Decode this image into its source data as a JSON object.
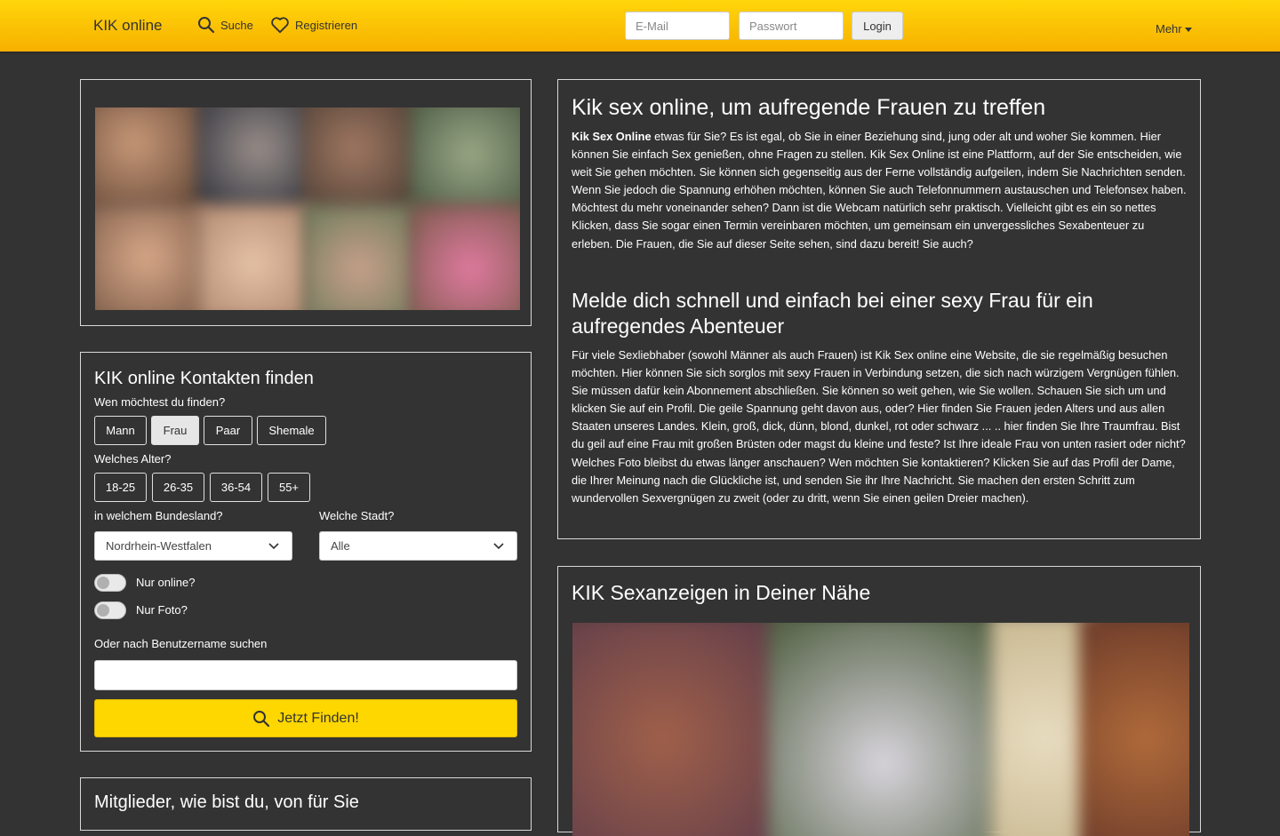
{
  "nav": {
    "brand": "KIK online",
    "search_label": "Suche",
    "register_label": "Registrieren",
    "email_placeholder": "E-Mail",
    "password_placeholder": "Passwort",
    "login_label": "Login",
    "more_label": "Mehr"
  },
  "search": {
    "title": "KIK online Kontakten finden",
    "who_label": "Wen möchtest du finden?",
    "genders": [
      "Mann",
      "Frau",
      "Paar",
      "Shemale"
    ],
    "gender_selected": "Frau",
    "age_label": "Welches Alter?",
    "ages": [
      "18-25",
      "26-35",
      "36-54",
      "55+"
    ],
    "state_label": "in welchem Bundesland?",
    "state_value": "Nordrhein-Westfalen",
    "city_label": "Welche Stadt?",
    "city_value": "Alle",
    "online_label": "Nur online?",
    "photo_label": "Nur Foto?",
    "username_label": "Oder nach Benutzername suchen",
    "username_value": "",
    "find_label": "Jetzt Finden!"
  },
  "members": {
    "title": "Mitglieder, wie bist du, von für Sie"
  },
  "article": {
    "title1": "Kik sex online, um aufregende Frauen zu treffen",
    "p1_strong": "Kik Sex Online",
    "p1_rest": " etwas für Sie? Es ist egal, ob Sie in einer Beziehung sind, jung oder alt und woher Sie kommen. Hier können Sie einfach Sex genießen, ohne Fragen zu stellen. Kik Sex Online ist eine Plattform, auf der Sie entscheiden, wie weit Sie gehen möchten. Sie können sich gegenseitig aus der Ferne vollständig aufgeilen, indem Sie Nachrichten senden. Wenn Sie jedoch die Spannung erhöhen möchten, können Sie auch Telefonnummern austauschen und Telefonsex haben. Möchtest du mehr voneinander sehen? Dann ist die Webcam natürlich sehr praktisch. Vielleicht gibt es ein so nettes Klicken, dass Sie sogar einen Termin vereinbaren möchten, um gemeinsam ein unvergessliches Sexabenteuer zu erleben. Die Frauen, die Sie auf dieser Seite sehen, sind dazu bereit! Sie auch?",
    "title2": "Melde dich schnell und einfach bei einer sexy Frau für ein aufregendes Abenteuer",
    "p2": "Für viele Sexliebhaber (sowohl Männer als auch Frauen) ist Kik Sex online eine Website, die sie regelmäßig besuchen möchten. Hier können Sie sich sorglos mit sexy Frauen in Verbindung setzen, die sich nach würzigem Vergnügen fühlen. Sie müssen dafür kein Abonnement abschließen. Sie können so weit gehen, wie Sie wollen. Schauen Sie sich um und klicken Sie auf ein Profil. Die geile Spannung geht davon aus, oder? Hier finden Sie Frauen jeden Alters und aus allen Staaten unseres Landes. Klein, groß, dick, dünn, blond, dunkel, rot oder schwarz ... .. hier finden Sie Ihre Traumfrau. Bist du geil auf eine Frau mit großen Brüsten oder magst du kleine und feste? Ist Ihre ideale Frau von unten rasiert oder nicht? Welches Foto bleibst du etwas länger anschauen? Wen möchten Sie kontaktieren? Klicken Sie auf das Profil der Dame, die Ihrer Meinung nach die Glückliche ist, und senden Sie ihr Ihre Nachricht. Sie machen den ersten Schritt zum wundervollen Sexvergnügen zu zweit (oder zu dritt, wenn Sie einen geilen Dreier machen)."
  },
  "ads": {
    "title": "KIK Sexanzeigen in Deiner Nähe"
  },
  "colors": {
    "nav_gradient_top": "#ffd60a",
    "nav_gradient_bottom": "#f7b000",
    "background": "#333333",
    "find_button": "#ffd700"
  }
}
